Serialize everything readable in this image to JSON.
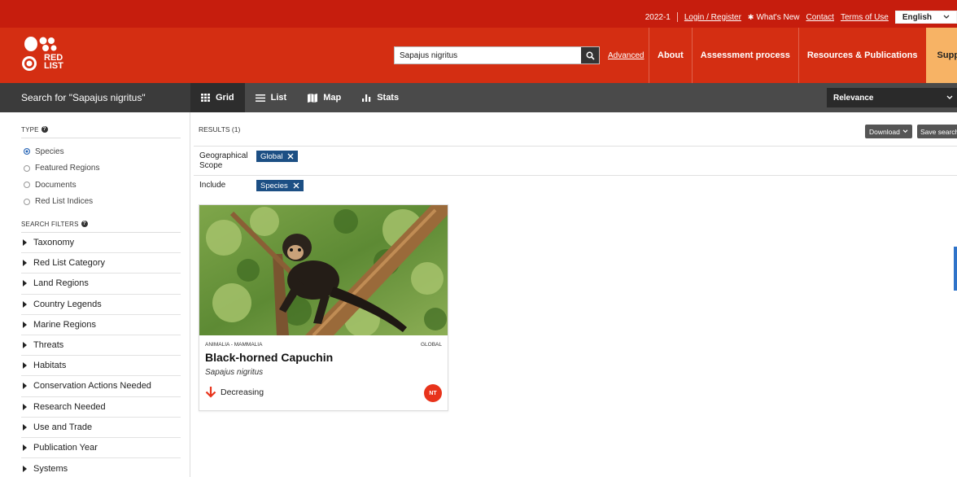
{
  "utility": {
    "year": "2022-1",
    "login": "Login / Register",
    "whats_new": "What's New",
    "contact": "Contact",
    "terms": "Terms of Use",
    "language": "English"
  },
  "header": {
    "logo_text": "RED LIST",
    "search_value": "Sapajus nigritus",
    "advanced": "Advanced",
    "nav": [
      "About",
      "Assessment process",
      "Resources & Publications",
      "Support us"
    ]
  },
  "toolbar": {
    "search_for": "Search for \"Sapajus nigritus\"",
    "views": [
      "Grid",
      "List",
      "Map",
      "Stats"
    ],
    "sort": "Relevance"
  },
  "sidebar": {
    "type_title": "TYPE",
    "types": [
      "Species",
      "Featured Regions",
      "Documents",
      "Red List Indices"
    ],
    "filters_title": "SEARCH FILTERS",
    "filters": [
      "Taxonomy",
      "Red List Category",
      "Land Regions",
      "Country Legends",
      "Marine Regions",
      "Threats",
      "Habitats",
      "Conservation Actions Needed",
      "Research Needed",
      "Use and Trade",
      "Publication Year",
      "Systems"
    ]
  },
  "results": {
    "count_label": "RESULTS (1)",
    "download": "Download",
    "save_search": "Save search",
    "geo_label": "Geographical Scope",
    "geo_chip": "Global",
    "include_label": "Include",
    "include_chip": "Species"
  },
  "card": {
    "taxonomy": "ANIMALIA - MAMMALIA",
    "scope": "GLOBAL",
    "common_name": "Black-horned Capuchin",
    "scientific_name": "Sapajus nigritus",
    "trend": "Decreasing",
    "category": "NT"
  },
  "colors": {
    "top_bar": "#c61d0d",
    "header": "#d42e12",
    "support": "#f7b365",
    "toolbar": "#4a4a4a",
    "chip": "#1c4f84",
    "badge": "#e8331b"
  }
}
